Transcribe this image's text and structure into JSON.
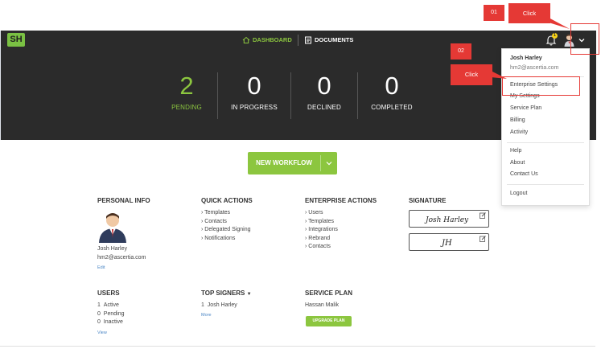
{
  "nav": {
    "logo": "SH",
    "dashboard": "DASHBOARD",
    "documents": "DOCUMENTS",
    "notification_count": "1"
  },
  "stats": [
    {
      "value": "2",
      "label": "PENDING"
    },
    {
      "value": "0",
      "label": "IN PROGRESS"
    },
    {
      "value": "0",
      "label": "DECLINED"
    },
    {
      "value": "0",
      "label": "COMPLETED"
    }
  ],
  "workflow_button": "NEW WORKFLOW",
  "personal_info": {
    "title": "PERSONAL INFO",
    "name": "Josh Harley",
    "email": "hm2@ascertia.com",
    "edit": "Edit"
  },
  "quick_actions": {
    "title": "QUICK ACTIONS",
    "items": [
      "Templates",
      "Contacts",
      "Delegated Signing",
      "Notifications"
    ]
  },
  "enterprise_actions": {
    "title": "ENTERPRISE ACTIONS",
    "items": [
      "Users",
      "Templates",
      "Integrations",
      "Rebrand",
      "Contacts"
    ]
  },
  "signature": {
    "title": "SIGNATURE",
    "full_sig": "Josh Harley",
    "initials": "JH"
  },
  "users": {
    "title": "USERS",
    "rows": [
      {
        "count": "1",
        "label": "Active"
      },
      {
        "count": "0",
        "label": "Pending"
      },
      {
        "count": "0",
        "label": "Inactive"
      }
    ],
    "view": "View"
  },
  "top_signers": {
    "title": "TOP SIGNERS",
    "rows": [
      {
        "count": "1",
        "label": "Josh Harley"
      }
    ],
    "more": "More"
  },
  "service_plan": {
    "title": "SERVICE PLAN",
    "owner": "Hassan Malik",
    "upgrade": "UPGRADE PLAN"
  },
  "dropdown": {
    "name": "Josh Harley",
    "email": "hm2@ascertia.com",
    "items": [
      "Enterprise Settings",
      "My Settings",
      "Service Plan",
      "Billing",
      "Activity"
    ],
    "help_items": [
      "Help",
      "About",
      "Contact Us"
    ],
    "logout": "Logout"
  },
  "callouts": [
    {
      "num": "01",
      "label": "Click"
    },
    {
      "num": "02",
      "label": "Click"
    }
  ],
  "colors": {
    "brand_green": "#8cc63f",
    "dark_bg": "#2b2b2b",
    "callout_red": "#e53935"
  }
}
